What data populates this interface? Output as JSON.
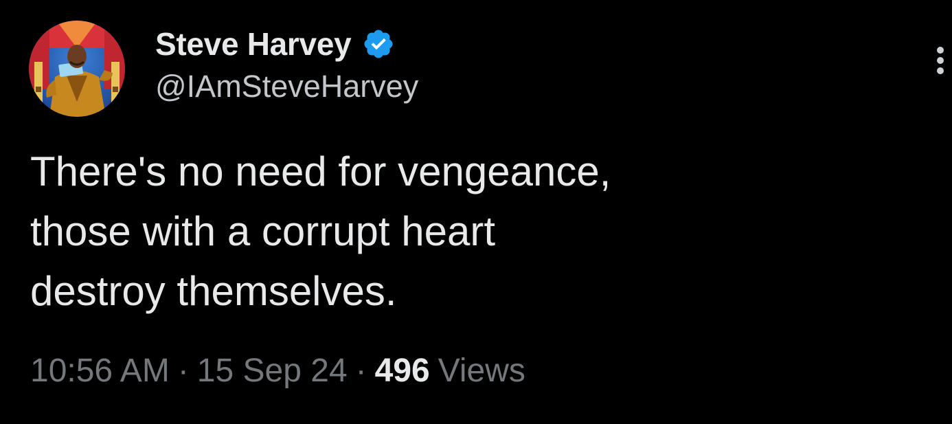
{
  "author": {
    "display_name": "Steve Harvey",
    "handle": "@IAmSteveHarvey",
    "verified": true,
    "avatar_icon": "profile-photo"
  },
  "tweet": {
    "text_lines": [
      "There's no need for vengeance,",
      "those with a corrupt heart",
      "destroy themselves."
    ],
    "time": "10:56 AM",
    "date": "15 Sep 24",
    "views_count": "496",
    "views_label": "Views",
    "separator": "·"
  },
  "icons": {
    "verified": "verified-badge-icon",
    "more": "more-options-icon"
  },
  "colors": {
    "background": "#000000",
    "primary_text": "#e7e9ea",
    "secondary_text": "#74787c",
    "verified_blue": "#1d9bf0"
  }
}
